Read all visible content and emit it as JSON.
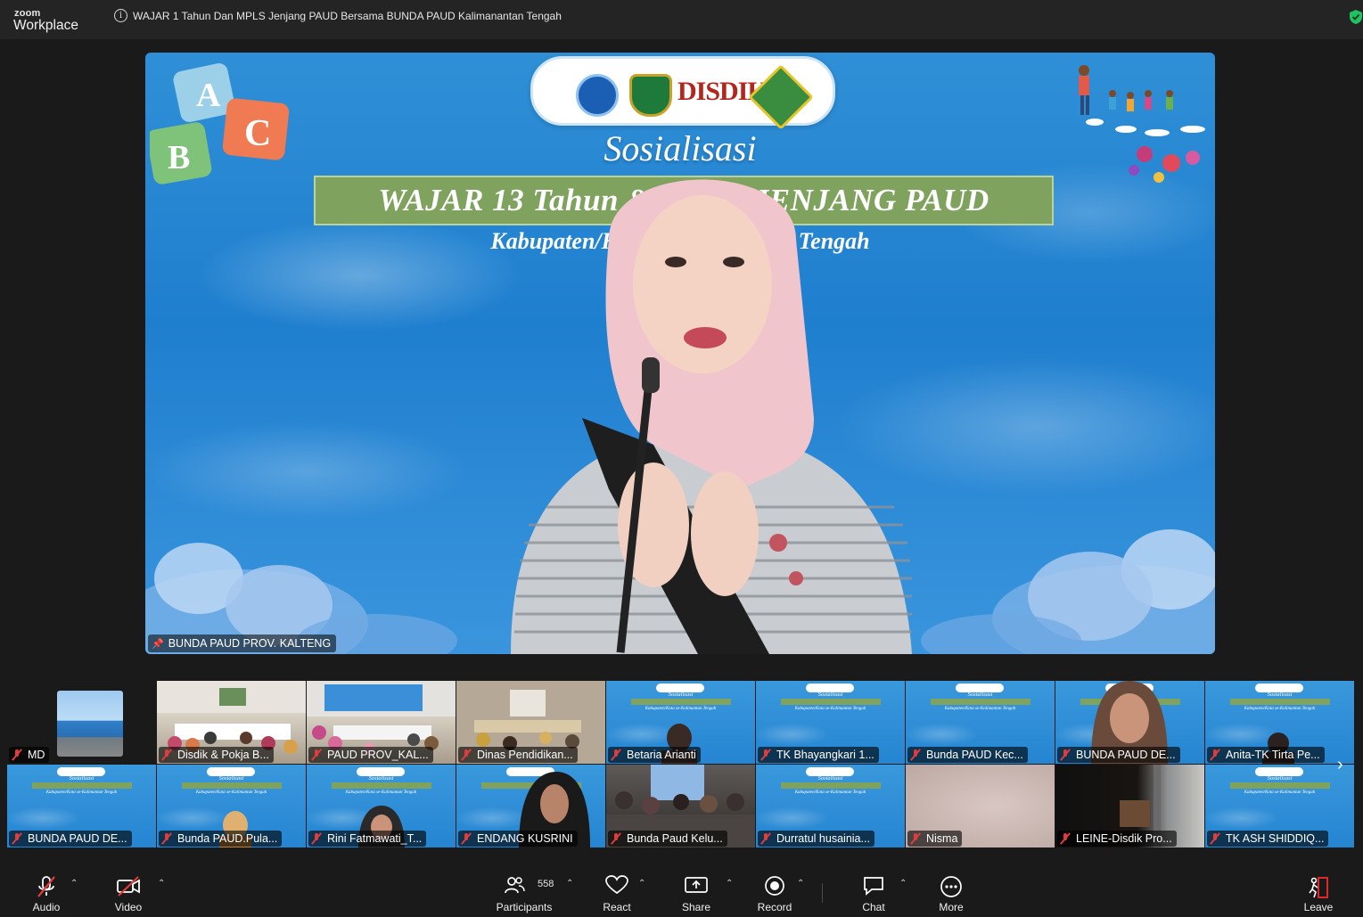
{
  "app": {
    "brand_small": "zoom",
    "brand_big": "Workplace"
  },
  "meeting": {
    "title": "WAJAR  1 Tahun Dan MPLS Jenjang PAUD Bersama BUNDA PAUD Kalimanantan Tengah"
  },
  "main_video": {
    "slide_heading": "Sosialisasi",
    "slide_banner": "WAJAR 13 Tahun & MPLS JENJANG PAUD",
    "slide_subtitle": "Kabupaten/Kota se-Kalimantan Tengah",
    "logo_text": "DISDIK",
    "speaker_name": "BUNDA PAUD PROV. KALTENG"
  },
  "gallery": {
    "self_view_name": "MD",
    "row1": [
      "Disdik & Pokja B...",
      "PAUD PROV_KAL...",
      "Dinas Pendidikan...",
      "Betaria Arianti",
      "TK Bhayangkari 1...",
      "Bunda PAUD Kec...",
      "BUNDA PAUD DE...",
      "Anita-TK Tirta Pe..."
    ],
    "row2": [
      "BUNDA PAUD DE...",
      "Bunda PAUD.Pula...",
      "Rini Fatmawati_T...",
      "ENDANG KUSRINI",
      "Bunda Paud Kelu...",
      "Durratul husainia...",
      "Nisma",
      "LEINE-Disdik Pro...",
      "TK ASH SHIDDIQ..."
    ],
    "next_label": "›"
  },
  "toolbar": {
    "audio": "Audio",
    "video": "Video",
    "participants": "Participants",
    "participants_count": "558",
    "react": "React",
    "share": "Share",
    "record": "Record",
    "chat": "Chat",
    "more": "More",
    "leave": "Leave"
  },
  "colors": {
    "accent_green": "#21c063",
    "mute_red": "#e03c3c",
    "leave_red": "#e02828"
  }
}
